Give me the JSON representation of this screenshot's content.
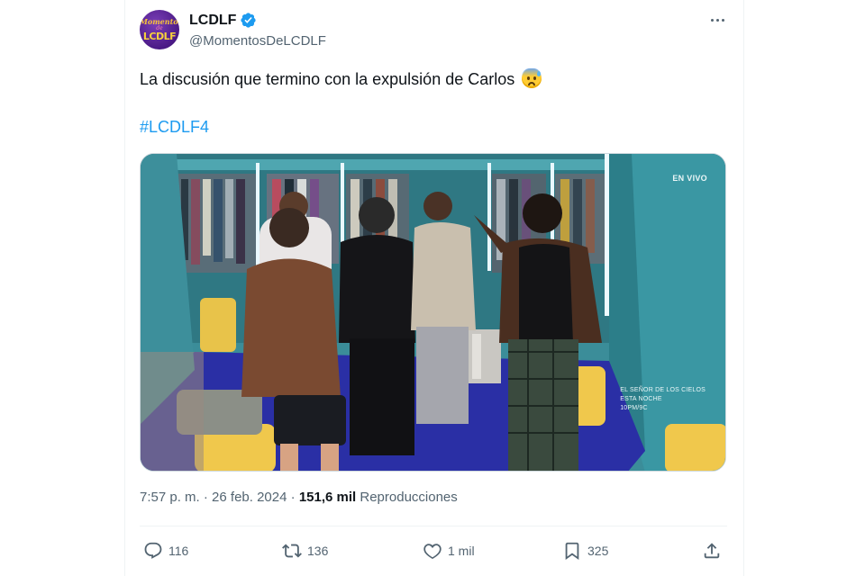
{
  "author": {
    "display_name": "LCDLF",
    "handle": "@MomentosDeLCDLF",
    "avatar_text_top": "Momentos",
    "avatar_text_mid": "de",
    "avatar_text_bottom": "LCDLF",
    "verified_icon": "verified-badge-icon"
  },
  "tweet": {
    "text": "La discusión que termino con la expulsión de Carlos",
    "emoji": "anxious-face-with-sweat",
    "hashtag": "#LCDLF4"
  },
  "media": {
    "overlay_live": "EN VIVO",
    "overlay_promo_line1": "EL SEÑOR DE LOS CIELOS",
    "overlay_promo_line2": "ESTA NOCHE",
    "overlay_promo_line3": "10PM/9C"
  },
  "meta": {
    "time": "7:57 p. m.",
    "separator": "·",
    "date": "26 feb. 2024",
    "views_count": "151,6 mil",
    "views_label": "Reproducciones"
  },
  "actions": {
    "replies": "116",
    "retweets": "136",
    "likes": "1 mil",
    "bookmarks": "325"
  },
  "colors": {
    "accent": "#1d9bf0",
    "text": "#0f1419",
    "muted": "#536471"
  }
}
